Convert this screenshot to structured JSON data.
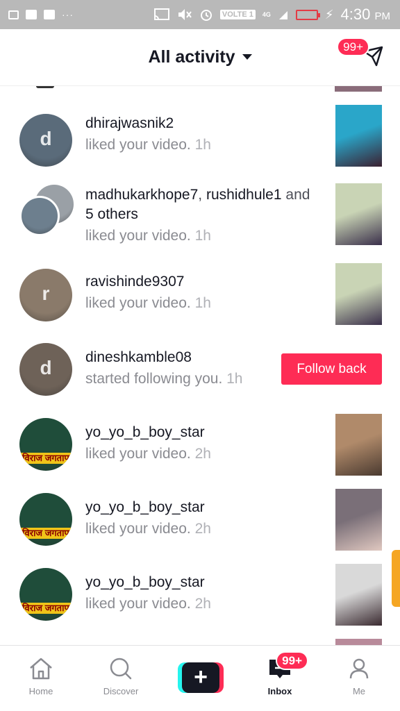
{
  "status_bar": {
    "network": "VOLTE 1",
    "net_type": "4G",
    "time": "4:30",
    "ampm": "PM",
    "icons": [
      "video-icon",
      "image-icon",
      "photo-icon",
      "more-dots-icon",
      "cast-icon",
      "mute-icon",
      "alarm-icon",
      "signal-icon",
      "battery-icon",
      "charging-icon"
    ]
  },
  "header": {
    "title": "All activity",
    "dm_badge": "99+"
  },
  "activities": [
    {
      "users": [
        "dhirajwasnik2"
      ],
      "action": "liked your video.",
      "time": "1h",
      "avatar_color": "#5a6b7a",
      "thumb_colors": [
        "#2aa6c9",
        "#3b2030"
      ]
    },
    {
      "users": [
        "madhukarkhope7",
        "rushidhule1"
      ],
      "and_text": "and",
      "others": "5 others",
      "action": "liked your video.",
      "time": "1h",
      "avatar_color": "#9aa0a6",
      "avatar2_color": "#6d7f8e",
      "thumb_colors": [
        "#c9d4b5",
        "#3a2f4a"
      ]
    },
    {
      "users": [
        "ravishinde9307"
      ],
      "action": "liked your video.",
      "time": "1h",
      "avatar_color": "#8a7a6a",
      "thumb_colors": [
        "#c9d4b5",
        "#3a2f4a"
      ]
    },
    {
      "users": [
        "dineshkamble08"
      ],
      "action": "started following you.",
      "time": "1h",
      "avatar_color": "#6e6258",
      "follow_back": "Follow back"
    },
    {
      "users": [
        "yo_yo_b_boy_star"
      ],
      "action": "liked your video.",
      "time": "2h",
      "avatar_color": "#1f4d3a",
      "banner": "विराज जगताप",
      "thumb_colors": [
        "#b08a6a",
        "#4a3a30"
      ]
    },
    {
      "users": [
        "yo_yo_b_boy_star"
      ],
      "action": "liked your video.",
      "time": "2h",
      "avatar_color": "#1f4d3a",
      "banner": "विराज जगताप",
      "thumb_colors": [
        "#7a6f78",
        "#e0c8c0"
      ]
    },
    {
      "users": [
        "yo_yo_b_boy_star"
      ],
      "action": "liked your video.",
      "time": "2h",
      "avatar_color": "#1f4d3a",
      "banner": "विराज जगताप",
      "thumb_colors": [
        "#d9d9d9",
        "#3a2a30"
      ]
    }
  ],
  "bottom_nav": {
    "home": "Home",
    "discover": "Discover",
    "create": "+",
    "inbox": "Inbox",
    "inbox_badge": "99+",
    "me": "Me"
  }
}
